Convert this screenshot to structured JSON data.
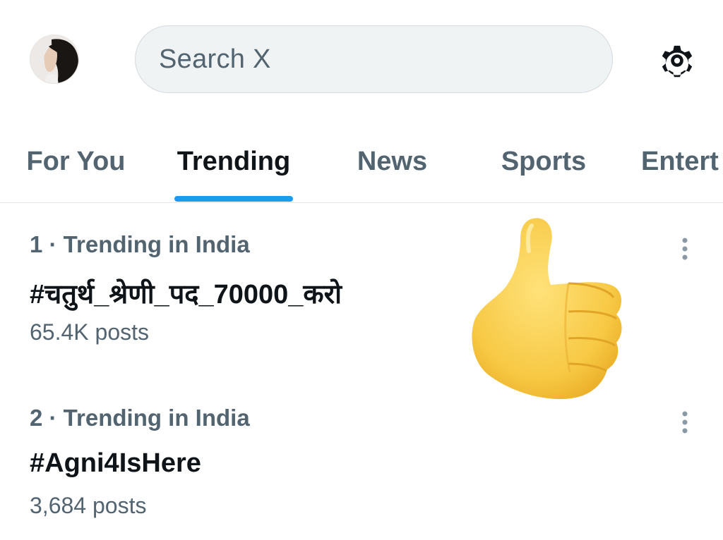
{
  "header": {
    "avatar_icon": "profile-avatar",
    "search": {
      "placeholder": "Search X",
      "icon": "none"
    },
    "settings_icon": "gear-icon"
  },
  "tabs": [
    {
      "label": "For You",
      "active": false
    },
    {
      "label": "Trending",
      "active": true
    },
    {
      "label": "News",
      "active": false
    },
    {
      "label": "Sports",
      "active": false
    },
    {
      "label": "Entert",
      "active": false
    }
  ],
  "trends": [
    {
      "meta": "1 · Trending in India",
      "title": "#चतुर्थ_श्रेणी_पद_70000_करो",
      "count": "65.4K posts"
    },
    {
      "meta": "2 · Trending in India",
      "title": "#Agni4IsHere",
      "count": "3,684 posts"
    }
  ],
  "overlay": {
    "emoji": "thumbs-up"
  },
  "colors": {
    "accent": "#1d9bf0",
    "text_primary": "#0f1419",
    "text_secondary": "#536471",
    "search_bg": "#eff3f4"
  }
}
